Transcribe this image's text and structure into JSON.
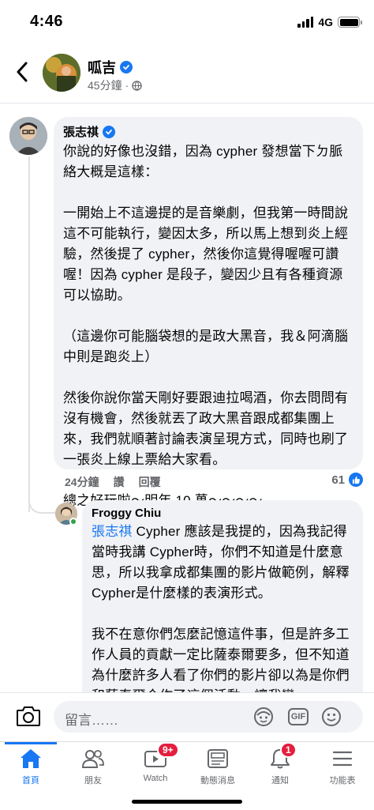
{
  "status_bar": {
    "time": "4:46",
    "network": "4G"
  },
  "header": {
    "page_name": "呱吉",
    "time_ago": "45分鐘",
    "separator": "·"
  },
  "comment1": {
    "author": "張志祺",
    "text": "你說的好像也沒錯，因為 cypher 發想當下ㄉ脈絡大概是這樣：\n\n一開始上不這邊提的是音樂劇，但我第一時間說這不可能執行，變因太多，所以馬上想到炎上經驗，然後提了 cypher，然後你這覺得喔喔可讚喔！因為 cypher 是段子，變因少且有各種資源可以協助。\n\n（這邊你可能腦袋想的是政大黑音，我＆阿滴腦中則是跑炎上）\n\n然後你說你當天剛好要跟迪拉喝酒，你去問問有沒有機會，然後就丟了政大黑音跟成都集團上來，我們就順著討論表演呈現方式，同時也刷了一張炎上線上票給大家看。\n\n總之好玩啦～明年 10 萬～～～～",
    "time_ago": "24分鐘",
    "like_label": "讚",
    "reply_label": "回覆",
    "reaction_count": "61"
  },
  "comment2": {
    "author": "Froggy Chiu",
    "mention": "張志祺",
    "text": " Cypher 應該是我提的，因為我記得當時我講 Cypher時，你們不知道是什麼意思，所以我拿成都集團的影片做範例，解釋Cypher是什麼樣的表演形式。\n\n我不在意你們怎麼記憶這件事，但是許多工作人員的貢獻一定比薩泰爾要多，但不知道為什麼許多人看了你們的影片卻以為是你們和薩泰爾合作了這個活動，讓我蠻"
  },
  "composer": {
    "placeholder": "留言……",
    "gif_label": "GIF"
  },
  "tabs": [
    {
      "label": "首頁",
      "icon": "home-icon"
    },
    {
      "label": "朋友",
      "icon": "friends-icon"
    },
    {
      "label": "Watch",
      "icon": "watch-icon",
      "badge": "9+"
    },
    {
      "label": "動態消息",
      "icon": "news-feed-icon"
    },
    {
      "label": "通知",
      "icon": "bell-icon",
      "badge": "1"
    },
    {
      "label": "功能表",
      "icon": "menu-icon"
    }
  ],
  "colors": {
    "accent": "#1877f2",
    "bubble": "#f0f2f5",
    "badge": "#e41e3f",
    "muted": "#65676b"
  }
}
